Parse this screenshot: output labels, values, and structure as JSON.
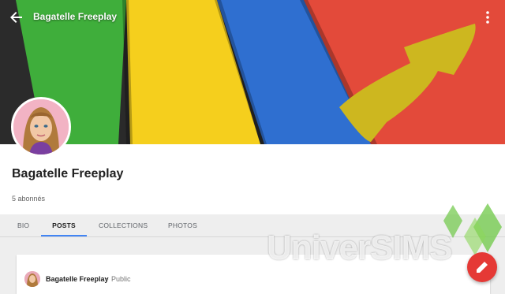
{
  "topbar": {
    "title": "Bagatelle Freeplay",
    "back_icon": "arrow-back-icon",
    "more_icon": "more-vert-icon"
  },
  "profile": {
    "name": "Bagatelle Freeplay",
    "followers": "5 abonnés"
  },
  "tabs": [
    {
      "label": "BIO",
      "active": false
    },
    {
      "label": "POSTS",
      "active": true
    },
    {
      "label": "COLLECTIONS",
      "active": false
    },
    {
      "label": "PHOTOS",
      "active": false
    }
  ],
  "post": {
    "author": "Bagatelle Freeplay",
    "visibility": "Public"
  },
  "watermark": {
    "text": "UniverSIMS"
  },
  "colors": {
    "accent": "#4285f4",
    "fab": "#e53935",
    "cover_green": "#3fae3b",
    "cover_yellow": "#f5cf1d",
    "cover_blue": "#2f6fd0",
    "cover_red": "#e34a3a",
    "arrow": "#cdb71f"
  }
}
